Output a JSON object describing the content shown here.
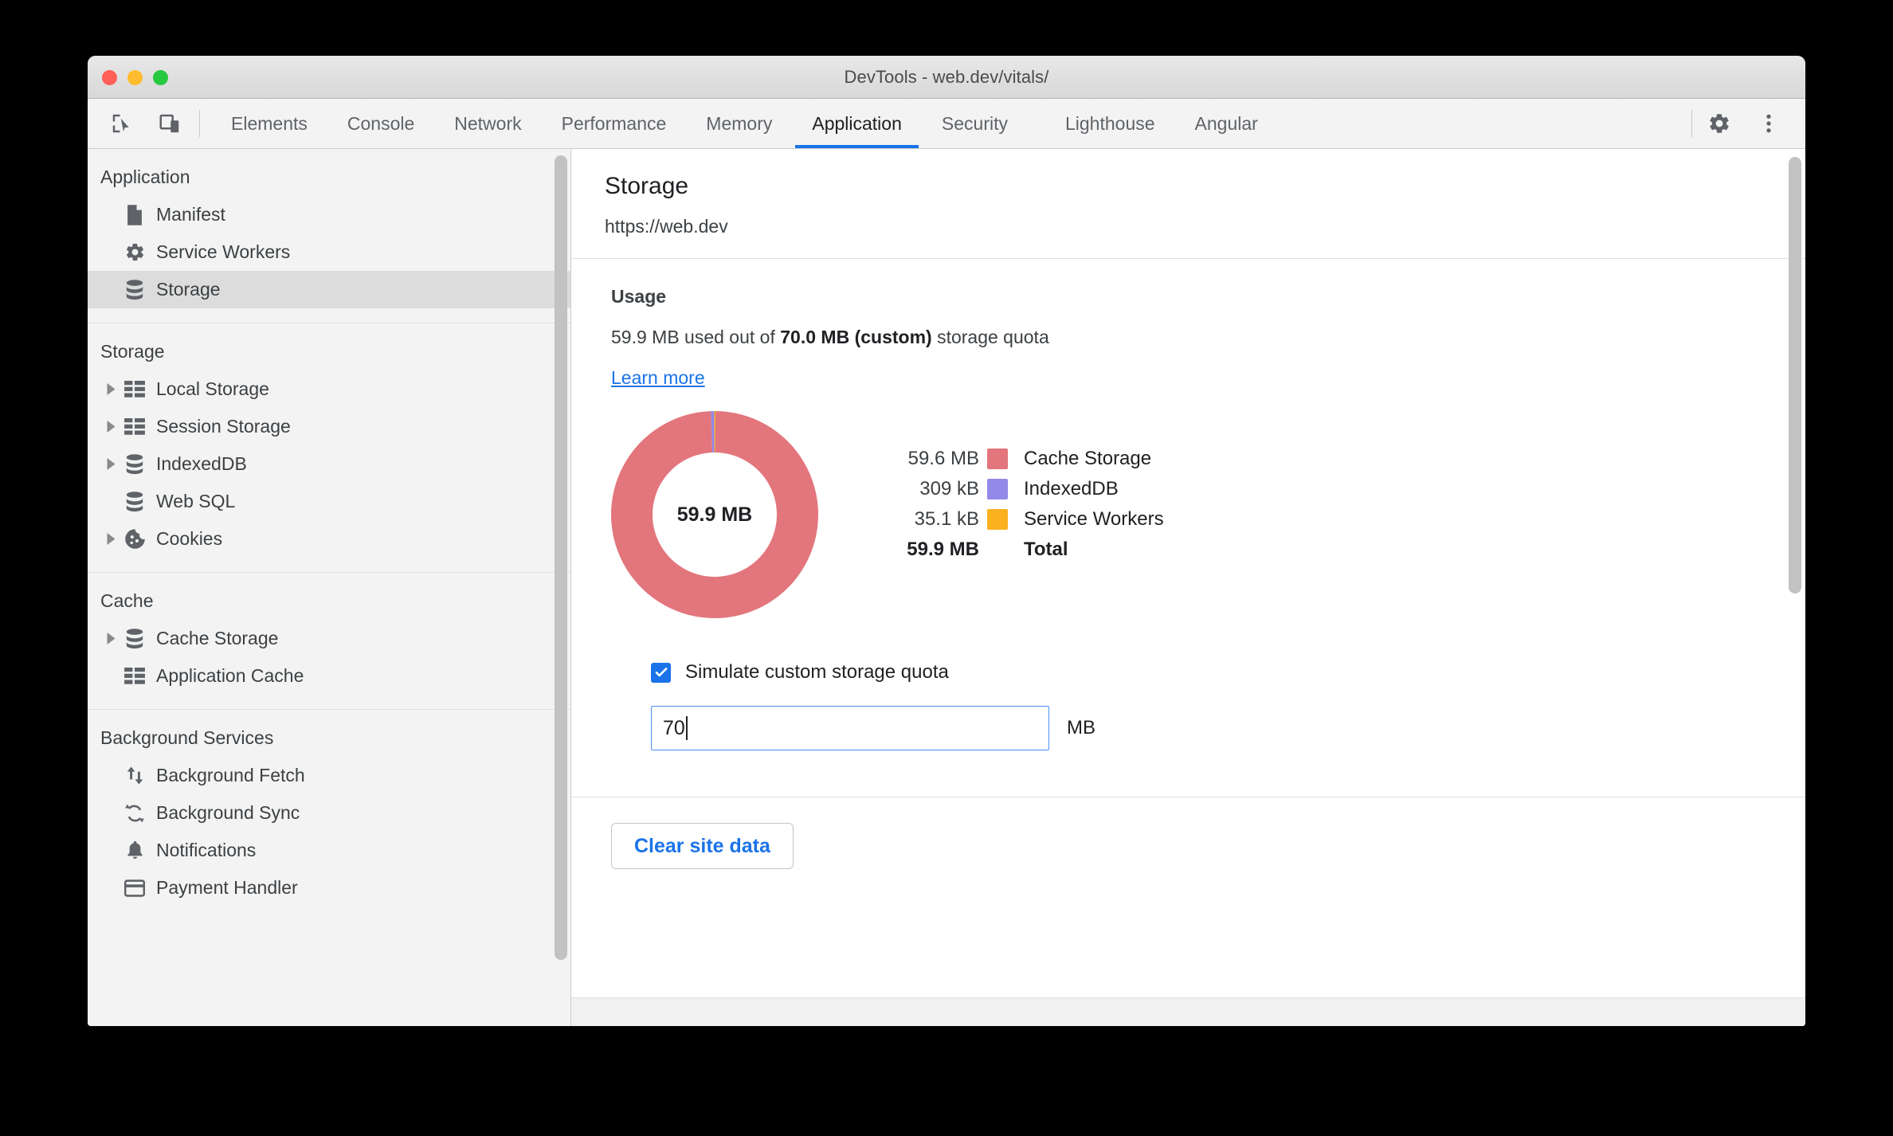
{
  "window": {
    "title": "DevTools - web.dev/vitals/",
    "traffic_lights": [
      "close",
      "minimize",
      "maximize"
    ]
  },
  "toolbar": {
    "inspect_icon": "inspect-element-icon",
    "device_icon": "device-toolbar-icon",
    "settings_icon": "gear-icon",
    "more_icon": "more-vertical-icon"
  },
  "tabs": [
    {
      "label": "Elements",
      "active": false
    },
    {
      "label": "Console",
      "active": false
    },
    {
      "label": "Network",
      "active": false
    },
    {
      "label": "Performance",
      "active": false
    },
    {
      "label": "Memory",
      "active": false
    },
    {
      "label": "Application",
      "active": true
    },
    {
      "label": "Security",
      "active": false
    },
    {
      "label": "Lighthouse",
      "active": false
    },
    {
      "label": "Angular",
      "active": false
    }
  ],
  "sidebar": {
    "sections": [
      {
        "title": "Application",
        "items": [
          {
            "label": "Manifest",
            "icon": "document-icon",
            "twisty": false,
            "selected": false
          },
          {
            "label": "Service Workers",
            "icon": "gear-icon",
            "twisty": false,
            "selected": false
          },
          {
            "label": "Storage",
            "icon": "database-icon",
            "twisty": false,
            "selected": true
          }
        ]
      },
      {
        "title": "Storage",
        "items": [
          {
            "label": "Local Storage",
            "icon": "table-icon",
            "twisty": true,
            "selected": false
          },
          {
            "label": "Session Storage",
            "icon": "table-icon",
            "twisty": true,
            "selected": false
          },
          {
            "label": "IndexedDB",
            "icon": "database-icon",
            "twisty": true,
            "selected": false
          },
          {
            "label": "Web SQL",
            "icon": "database-icon",
            "twisty": false,
            "selected": false
          },
          {
            "label": "Cookies",
            "icon": "cookie-icon",
            "twisty": true,
            "selected": false
          }
        ]
      },
      {
        "title": "Cache",
        "items": [
          {
            "label": "Cache Storage",
            "icon": "database-icon",
            "twisty": true,
            "selected": false
          },
          {
            "label": "Application Cache",
            "icon": "table-icon",
            "twisty": false,
            "selected": false
          }
        ]
      },
      {
        "title": "Background Services",
        "items": [
          {
            "label": "Background Fetch",
            "icon": "arrows-up-down-icon",
            "twisty": false,
            "selected": false
          },
          {
            "label": "Background Sync",
            "icon": "sync-icon",
            "twisty": false,
            "selected": false
          },
          {
            "label": "Notifications",
            "icon": "bell-icon",
            "twisty": false,
            "selected": false
          },
          {
            "label": "Payment Handler",
            "icon": "credit-card-icon",
            "twisty": false,
            "selected": false
          }
        ]
      }
    ]
  },
  "main": {
    "title": "Storage",
    "origin": "https://web.dev",
    "usage_heading": "Usage",
    "usage_prefix": "59.9 MB used out of ",
    "usage_quota": "70.0 MB (custom)",
    "usage_suffix": " storage quota",
    "learn_more": "Learn more",
    "donut_center": "59.9 MB",
    "quota_checkbox_label": "Simulate custom storage quota",
    "quota_checkbox_checked": true,
    "quota_value": "70",
    "quota_unit": "MB",
    "clear_button": "Clear site data"
  },
  "chart_data": {
    "type": "pie",
    "title": "Storage usage breakdown",
    "categories": [
      "Cache Storage",
      "IndexedDB",
      "Service Workers"
    ],
    "values": [
      59600000,
      309000,
      35100
    ],
    "value_labels": [
      "59.6 MB",
      "309 kB",
      "35.1 kB"
    ],
    "colors": [
      "#e3757c",
      "#9289e8",
      "#fbb01f"
    ],
    "total_label": "Total",
    "total_value": "59.9 MB",
    "center_label": "59.9 MB",
    "legend_position": "right",
    "donut": true,
    "inner_radius_ratio": 0.6
  },
  "colors": {
    "accent_blue": "#1a73e8",
    "cache_storage": "#e3757c",
    "indexeddb": "#9289e8",
    "service_workers": "#fbb01f",
    "selected_row": "#dcdcdc"
  }
}
